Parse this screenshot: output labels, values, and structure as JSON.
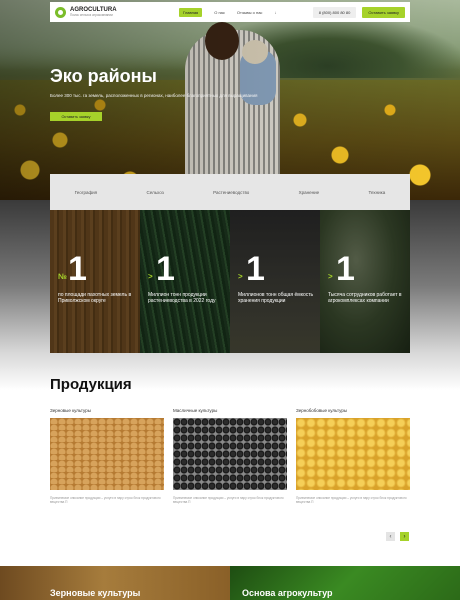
{
  "header": {
    "logo_title": "AGROCULTURA",
    "logo_sub": "Поиск сельхоз агрокомпании",
    "nav": [
      "Главная",
      "О нас",
      "Отзывы о нас"
    ],
    "nav_extra": "↓",
    "phone": "8 (800) 800 80 80",
    "cta": "Оставить заявку"
  },
  "hero": {
    "title": "Эко районы",
    "subtitle": "Более 300 тыс. га земель, расположенных в регионах, наиболее благоприятных для выращивания",
    "button": "Оставить заявку"
  },
  "tabs": [
    "География",
    "Сельхоз",
    "Растениеводство",
    "Хранение",
    "Техника"
  ],
  "stats": [
    {
      "prefix": "№",
      "value": "1",
      "desc": "по площади пахотных земель в Приволжском округе"
    },
    {
      "prefix": ">",
      "value": "1",
      "desc": "Миллион тонн продукции растениеводства в 2022 году"
    },
    {
      "prefix": ">",
      "value": "1",
      "desc": "Миллионов тонн общая ёмкость хранения продукции"
    },
    {
      "prefix": ">",
      "value": "1",
      "desc": "Тысяча сотрудников работает в агрокомплексах компании"
    }
  ],
  "products": {
    "title": "Продукция",
    "items": [
      {
        "name": "Зерновые культуры",
        "desc": "Приемлемое описание продукции – услуги в пару строк блок продуктового вещества П"
      },
      {
        "name": "Масличные культуры",
        "desc": "Приемлемое описание продукции – услуги в пару строк блок продуктового вещества П"
      },
      {
        "name": "Зернобобовые культуры",
        "desc": "Приемлемое описание продукции – услуги в пару строк блок продуктового вещества П"
      }
    ],
    "prev_icon": "‹",
    "next_icon": "›"
  },
  "bottom": {
    "left_title": "Зерновые культуры",
    "right_title": "Основа агрокультур"
  },
  "colors": {
    "accent": "#a6d22a",
    "tabs_bg": "#e6e6e6"
  }
}
